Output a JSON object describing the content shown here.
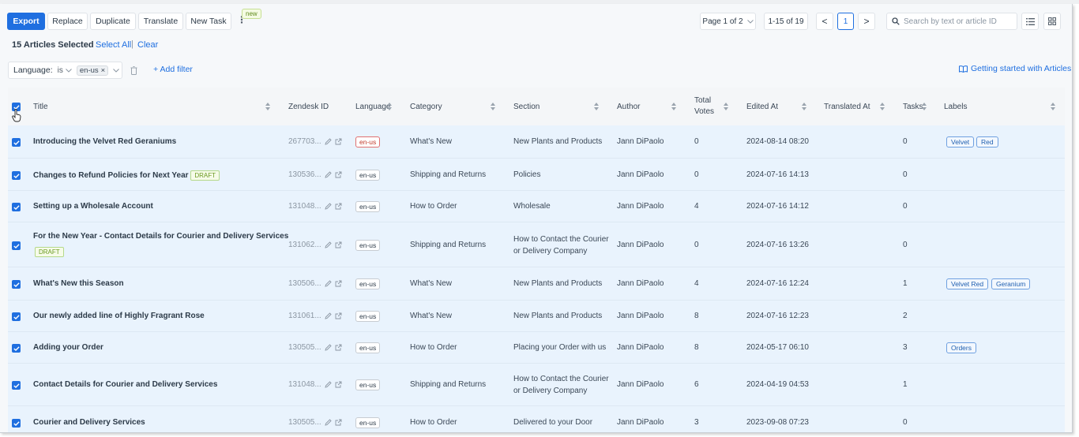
{
  "toolbar": {
    "export": "Export",
    "replace": "Replace",
    "duplicate": "Duplicate",
    "translate": "Translate",
    "new_task": "New Task",
    "more": "⋮",
    "new_badge": "new"
  },
  "pagination": {
    "page_select": "Page 1 of 2",
    "range": "1-15 of 19",
    "prev": "<",
    "current": "1",
    "next": ">"
  },
  "search": {
    "placeholder": "Search by text or article ID"
  },
  "selection": {
    "count_text": "15 Articles Selected",
    "select_all": "Select All",
    "separator": "|",
    "clear": "Clear"
  },
  "filter": {
    "field": "Language:",
    "operator": "is",
    "value": "en-us",
    "remove": "×",
    "add_filter": "+ Add filter"
  },
  "help_link": "Getting started with Articles",
  "columns": {
    "title": "Title",
    "zendesk_id": "Zendesk ID",
    "language": "Language",
    "category": "Category",
    "section": "Section",
    "author": "Author",
    "total_votes_1": "Total",
    "total_votes_2": "Votes",
    "edited_at": "Edited At",
    "translated_at": "Translated At",
    "tasks": "Tasks",
    "labels": "Labels"
  },
  "rows": [
    {
      "title": "Introducing the Velvet Red Geraniums",
      "draft": "",
      "zid": "267703...",
      "lang": "en-us",
      "category": "What's New",
      "section_1": "New Plants and Products",
      "section_2": "",
      "author": "Jann DiPaolo",
      "votes": "0",
      "edited": "2024-08-14 08:20",
      "tasks": "0",
      "label_1": "Velvet",
      "label_2": "Red"
    },
    {
      "title": "Changes to Refund Policies for Next Year",
      "draft": "DRAFT",
      "zid": "130536...",
      "lang": "en-us",
      "category": "Shipping and Returns",
      "section_1": "Policies",
      "section_2": "",
      "author": "Jann DiPaolo",
      "votes": "0",
      "edited": "2024-07-16 14:13",
      "tasks": "0",
      "label_1": "",
      "label_2": ""
    },
    {
      "title": "Setting up a Wholesale Account",
      "draft": "",
      "zid": "131048...",
      "lang": "en-us",
      "category": "How to Order",
      "section_1": "Wholesale",
      "section_2": "",
      "author": "Jann DiPaolo",
      "votes": "4",
      "edited": "2024-07-16 14:12",
      "tasks": "0",
      "label_1": "",
      "label_2": ""
    },
    {
      "title": "For the New Year - Contact Details for Courier and Delivery Services",
      "draft": "DRAFT",
      "zid": "131062...",
      "lang": "en-us",
      "category": "Shipping and Returns",
      "section_1": "How to Contact the Courier",
      "section_2": "or Delivery Company",
      "author": "Jann DiPaolo",
      "votes": "0",
      "edited": "2024-07-16 13:26",
      "tasks": "0",
      "label_1": "",
      "label_2": ""
    },
    {
      "title": "What's New this Season",
      "draft": "",
      "zid": "130506...",
      "lang": "en-us",
      "category": "What's New",
      "section_1": "New Plants and Products",
      "section_2": "",
      "author": "Jann DiPaolo",
      "votes": "4",
      "edited": "2024-07-16 12:24",
      "tasks": "1",
      "label_1": "Velvet Red",
      "label_2": "Geranium"
    },
    {
      "title": "Our newly added line of Highly Fragrant Rose",
      "draft": "",
      "zid": "131061...",
      "lang": "en-us",
      "category": "What's New",
      "section_1": "New Plants and Products",
      "section_2": "",
      "author": "Jann DiPaolo",
      "votes": "8",
      "edited": "2024-07-16 12:23",
      "tasks": "2",
      "label_1": "",
      "label_2": ""
    },
    {
      "title": "Adding your Order",
      "draft": "",
      "zid": "130505...",
      "lang": "en-us",
      "category": "How to Order",
      "section_1": "Placing your Order with us",
      "section_2": "",
      "author": "Jann DiPaolo",
      "votes": "8",
      "edited": "2024-05-17 06:10",
      "tasks": "3",
      "label_1": "Orders",
      "label_2": ""
    },
    {
      "title": "Contact Details for Courier and Delivery Services",
      "draft": "",
      "zid": "131048...",
      "lang": "en-us",
      "category": "Shipping and Returns",
      "section_1": "How to Contact the Courier",
      "section_2": "or Delivery Company",
      "author": "Jann DiPaolo",
      "votes": "6",
      "edited": "2024-04-19 04:53",
      "tasks": "1",
      "label_1": "",
      "label_2": ""
    },
    {
      "title": "Courier and Delivery Services",
      "draft": "",
      "zid": "130505...",
      "lang": "en-us",
      "category": "How to Order",
      "section_1": "Delivered to your Door",
      "section_2": "",
      "author": "Jann DiPaolo",
      "votes": "3",
      "edited": "2023-09-08 07:23",
      "tasks": "0",
      "label_1": "",
      "label_2": ""
    }
  ],
  "colors": {
    "accent": "#1f6fe0",
    "selected_row": "#e9f3fd",
    "draft": "#6a9a1f",
    "lang_warning": "#c0392b"
  }
}
